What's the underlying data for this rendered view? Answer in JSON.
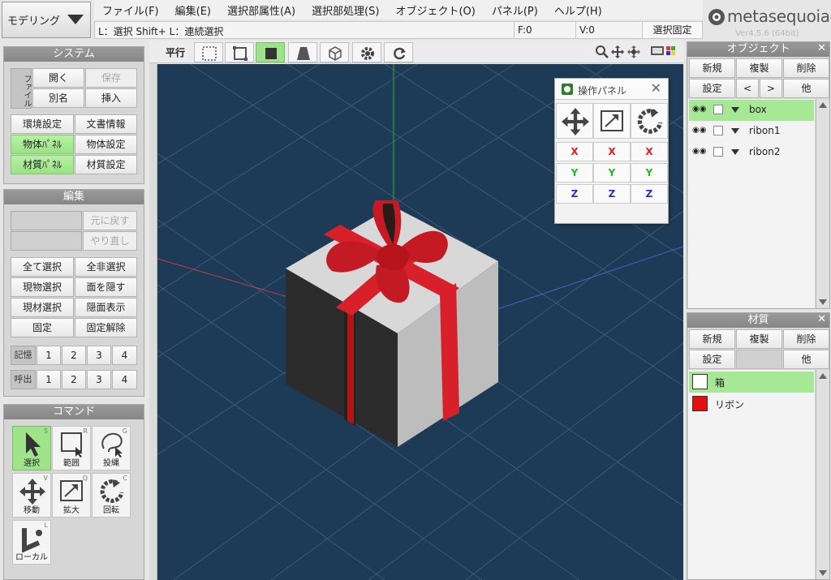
{
  "mode": {
    "label": "モデリング"
  },
  "menu": [
    "ファイル(F)",
    "編集(E)",
    "選択部属性(A)",
    "選択部処理(S)",
    "オブジェクト(O)",
    "パネル(P)",
    "ヘルプ(H)"
  ],
  "status": {
    "hint": "L：選択  Shift+ L：連続選択",
    "face": "F:0",
    "vertex": "V:0",
    "lock_button": "選択固定"
  },
  "logo": {
    "name": "metasequoia4",
    "version": "Ver4.5.6 (64bit)"
  },
  "system": {
    "title": "システム",
    "file_label": "ファイル",
    "open": "開く",
    "save": "保存",
    "rename": "別名",
    "insert": "挿入",
    "env": "環境設定",
    "docinfo": "文書情報",
    "obj_panel": "物体ﾊﾟﾈﾙ",
    "obj_settings": "物体設定",
    "mat_panel": "材質ﾊﾟﾈﾙ",
    "mat_settings": "材質設定"
  },
  "edit": {
    "title": "編集",
    "undo": "元に戻す",
    "redo": "やり直し",
    "select_all": "全て選択",
    "deselect_all": "全非選択",
    "select_current_obj": "現物選択",
    "hide_face": "面を隠す",
    "select_current_mat": "現材選択",
    "show_hidden": "隠面表示",
    "lock": "固定",
    "unlock": "固定解除",
    "memory_label": "記憶",
    "recall_label": "呼出",
    "slots": [
      "1",
      "2",
      "3",
      "4"
    ]
  },
  "command": {
    "title": "コマンド",
    "tools": [
      {
        "label": "選択",
        "key": "S"
      },
      {
        "label": "範囲",
        "key": "R"
      },
      {
        "label": "投縄",
        "key": "G"
      },
      {
        "label": "移動",
        "key": "V"
      },
      {
        "label": "拡大",
        "key": "Q"
      },
      {
        "label": "回転",
        "key": "C"
      },
      {
        "label": "ローカル",
        "key": "L"
      }
    ]
  },
  "toolbar": {
    "projection": "平行"
  },
  "op_panel": {
    "title": "操作パネル",
    "axes": [
      "X",
      "Y",
      "Z"
    ],
    "colors": {
      "x": "#e02020",
      "y": "#22bb22",
      "z": "#2233cc"
    }
  },
  "objects": {
    "title": "オブジェクト",
    "new": "新規",
    "duplicate": "複製",
    "delete": "削除",
    "settings": "設定",
    "prev": "<",
    "next": ">",
    "other": "他",
    "items": [
      {
        "name": "box"
      },
      {
        "name": "ribon1"
      },
      {
        "name": "ribon2"
      }
    ]
  },
  "materials": {
    "title": "材質",
    "new": "新規",
    "duplicate": "複製",
    "delete": "削除",
    "settings": "設定",
    "other": "他",
    "items": [
      {
        "name": "箱",
        "color": "#ffffff"
      },
      {
        "name": "リボン",
        "color": "#e31010"
      }
    ]
  },
  "colors": {
    "viewport_bg": "#1d3b56",
    "active_green": "#9ee389",
    "ribbon": "#d8202a"
  }
}
